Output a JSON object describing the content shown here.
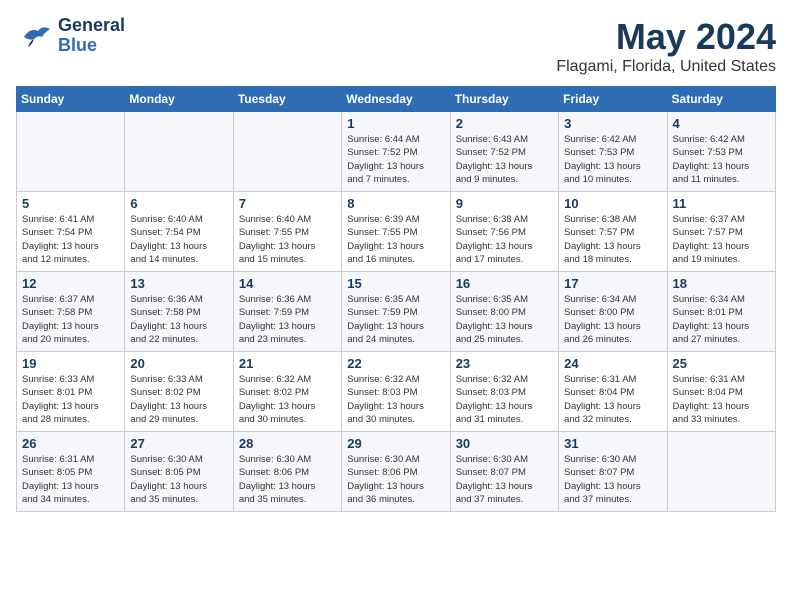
{
  "header": {
    "logo_general": "General",
    "logo_blue": "Blue",
    "title": "May 2024",
    "location": "Flagami, Florida, United States"
  },
  "weekdays": [
    "Sunday",
    "Monday",
    "Tuesday",
    "Wednesday",
    "Thursday",
    "Friday",
    "Saturday"
  ],
  "weeks": [
    [
      {
        "day": "",
        "info": ""
      },
      {
        "day": "",
        "info": ""
      },
      {
        "day": "",
        "info": ""
      },
      {
        "day": "1",
        "info": "Sunrise: 6:44 AM\nSunset: 7:52 PM\nDaylight: 13 hours\nand 7 minutes."
      },
      {
        "day": "2",
        "info": "Sunrise: 6:43 AM\nSunset: 7:52 PM\nDaylight: 13 hours\nand 9 minutes."
      },
      {
        "day": "3",
        "info": "Sunrise: 6:42 AM\nSunset: 7:53 PM\nDaylight: 13 hours\nand 10 minutes."
      },
      {
        "day": "4",
        "info": "Sunrise: 6:42 AM\nSunset: 7:53 PM\nDaylight: 13 hours\nand 11 minutes."
      }
    ],
    [
      {
        "day": "5",
        "info": "Sunrise: 6:41 AM\nSunset: 7:54 PM\nDaylight: 13 hours\nand 12 minutes."
      },
      {
        "day": "6",
        "info": "Sunrise: 6:40 AM\nSunset: 7:54 PM\nDaylight: 13 hours\nand 14 minutes."
      },
      {
        "day": "7",
        "info": "Sunrise: 6:40 AM\nSunset: 7:55 PM\nDaylight: 13 hours\nand 15 minutes."
      },
      {
        "day": "8",
        "info": "Sunrise: 6:39 AM\nSunset: 7:55 PM\nDaylight: 13 hours\nand 16 minutes."
      },
      {
        "day": "9",
        "info": "Sunrise: 6:38 AM\nSunset: 7:56 PM\nDaylight: 13 hours\nand 17 minutes."
      },
      {
        "day": "10",
        "info": "Sunrise: 6:38 AM\nSunset: 7:57 PM\nDaylight: 13 hours\nand 18 minutes."
      },
      {
        "day": "11",
        "info": "Sunrise: 6:37 AM\nSunset: 7:57 PM\nDaylight: 13 hours\nand 19 minutes."
      }
    ],
    [
      {
        "day": "12",
        "info": "Sunrise: 6:37 AM\nSunset: 7:58 PM\nDaylight: 13 hours\nand 20 minutes."
      },
      {
        "day": "13",
        "info": "Sunrise: 6:36 AM\nSunset: 7:58 PM\nDaylight: 13 hours\nand 22 minutes."
      },
      {
        "day": "14",
        "info": "Sunrise: 6:36 AM\nSunset: 7:59 PM\nDaylight: 13 hours\nand 23 minutes."
      },
      {
        "day": "15",
        "info": "Sunrise: 6:35 AM\nSunset: 7:59 PM\nDaylight: 13 hours\nand 24 minutes."
      },
      {
        "day": "16",
        "info": "Sunrise: 6:35 AM\nSunset: 8:00 PM\nDaylight: 13 hours\nand 25 minutes."
      },
      {
        "day": "17",
        "info": "Sunrise: 6:34 AM\nSunset: 8:00 PM\nDaylight: 13 hours\nand 26 minutes."
      },
      {
        "day": "18",
        "info": "Sunrise: 6:34 AM\nSunset: 8:01 PM\nDaylight: 13 hours\nand 27 minutes."
      }
    ],
    [
      {
        "day": "19",
        "info": "Sunrise: 6:33 AM\nSunset: 8:01 PM\nDaylight: 13 hours\nand 28 minutes."
      },
      {
        "day": "20",
        "info": "Sunrise: 6:33 AM\nSunset: 8:02 PM\nDaylight: 13 hours\nand 29 minutes."
      },
      {
        "day": "21",
        "info": "Sunrise: 6:32 AM\nSunset: 8:02 PM\nDaylight: 13 hours\nand 30 minutes."
      },
      {
        "day": "22",
        "info": "Sunrise: 6:32 AM\nSunset: 8:03 PM\nDaylight: 13 hours\nand 30 minutes."
      },
      {
        "day": "23",
        "info": "Sunrise: 6:32 AM\nSunset: 8:03 PM\nDaylight: 13 hours\nand 31 minutes."
      },
      {
        "day": "24",
        "info": "Sunrise: 6:31 AM\nSunset: 8:04 PM\nDaylight: 13 hours\nand 32 minutes."
      },
      {
        "day": "25",
        "info": "Sunrise: 6:31 AM\nSunset: 8:04 PM\nDaylight: 13 hours\nand 33 minutes."
      }
    ],
    [
      {
        "day": "26",
        "info": "Sunrise: 6:31 AM\nSunset: 8:05 PM\nDaylight: 13 hours\nand 34 minutes."
      },
      {
        "day": "27",
        "info": "Sunrise: 6:30 AM\nSunset: 8:05 PM\nDaylight: 13 hours\nand 35 minutes."
      },
      {
        "day": "28",
        "info": "Sunrise: 6:30 AM\nSunset: 8:06 PM\nDaylight: 13 hours\nand 35 minutes."
      },
      {
        "day": "29",
        "info": "Sunrise: 6:30 AM\nSunset: 8:06 PM\nDaylight: 13 hours\nand 36 minutes."
      },
      {
        "day": "30",
        "info": "Sunrise: 6:30 AM\nSunset: 8:07 PM\nDaylight: 13 hours\nand 37 minutes."
      },
      {
        "day": "31",
        "info": "Sunrise: 6:30 AM\nSunset: 8:07 PM\nDaylight: 13 hours\nand 37 minutes."
      },
      {
        "day": "",
        "info": ""
      }
    ]
  ]
}
